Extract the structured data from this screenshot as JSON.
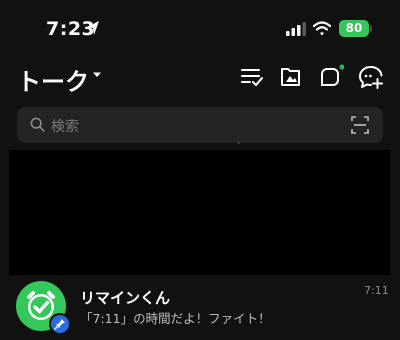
{
  "status_bar": {
    "time": "7:23",
    "battery": "80"
  },
  "header": {
    "title": "トーク",
    "icons": [
      "list-check-icon",
      "album-icon",
      "openchat-icon",
      "new-chat-icon"
    ],
    "new_indicator_color": "#06c755"
  },
  "search": {
    "placeholder": "検索"
  },
  "chats": [
    {
      "name": "リマインくん",
      "last_message": "「7:11」の時間だよ！ファイト！",
      "time": "7:11",
      "pinned": true
    }
  ],
  "colors": {
    "background": "#111111",
    "accent": "#06c755",
    "avatar": "#34c759",
    "battery": "#35c759"
  }
}
